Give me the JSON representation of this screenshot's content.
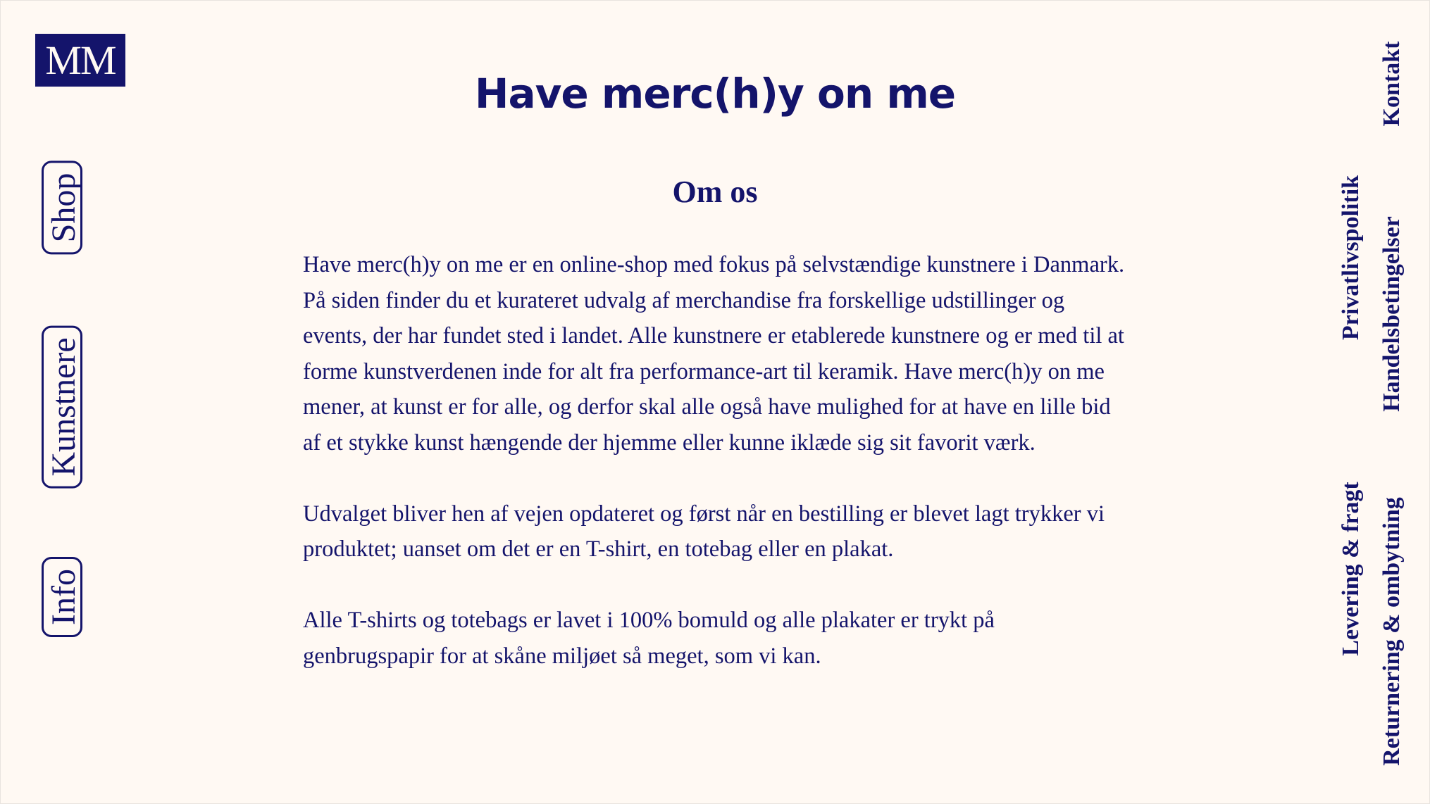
{
  "logo": {
    "text": "MM"
  },
  "left_nav": {
    "shop": "Shop",
    "artists": "Kunstnere",
    "info": "Info"
  },
  "header": {
    "title": "Have merc(h)y on me"
  },
  "about": {
    "heading": "Om os",
    "paragraphs": [
      "Have merc(h)y on me er en online-shop med fokus på selvstændige kunstnere i Danmark. På siden finder du et kurateret udvalg af merchandise fra forskellige udstillinger og events, der har fundet sted i landet. Alle kunstnere er etablerede kunstnere og er med til at forme kunstverdenen inde for alt fra performance-art til keramik. Have merc(h)y on me mener, at kunst er for alle, og derfor skal alle også have mulighed for at have en lille bid af et stykke kunst hængende der hjemme eller kunne iklæde sig sit favorit værk.",
      "Udvalget bliver hen af vejen opdateret og først når en bestilling er blevet lagt trykker vi produktet; uanset om det er en T-shirt, en totebag eller en plakat.",
      "Alle T-shirts og totebags er lavet i 100% bomuld og alle plakater er trykt på genbrugspapir for at skåne miljøet så meget, som vi kan."
    ]
  },
  "right_nav": {
    "contact": "Kontakt",
    "privacy": "Privatlivspolitik",
    "terms": "Handelsbetingelser",
    "shipping": "Levering & fragt",
    "returns": "Returnering & ombytning"
  },
  "colors": {
    "navy": "#14146b",
    "background": "#fff9f3"
  }
}
